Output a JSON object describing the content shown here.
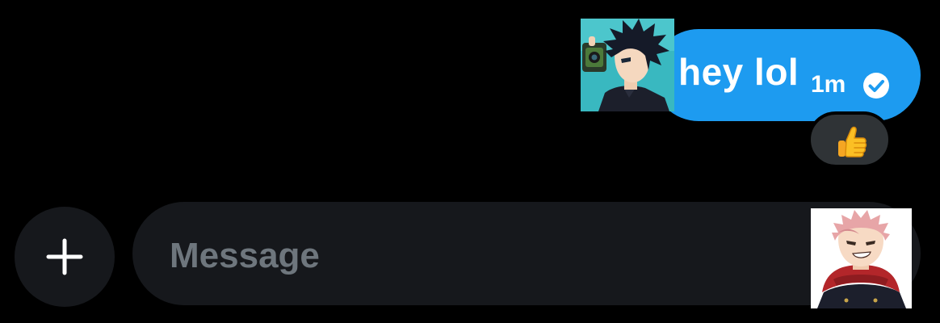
{
  "thread": {
    "messages": [
      {
        "text": "hey lol",
        "time": "1m",
        "status_icon": "check-circle-icon",
        "reaction_icon": "thumbs-up-emoji",
        "bubble_color": "#1d9bf0"
      }
    ]
  },
  "composer": {
    "placeholder": "Message",
    "add_icon": "plus-icon",
    "background": "#16181c"
  },
  "avatars": {
    "sender_icon": "anime-avatar-dark-hair",
    "me_icon": "anime-avatar-pink-hair"
  }
}
